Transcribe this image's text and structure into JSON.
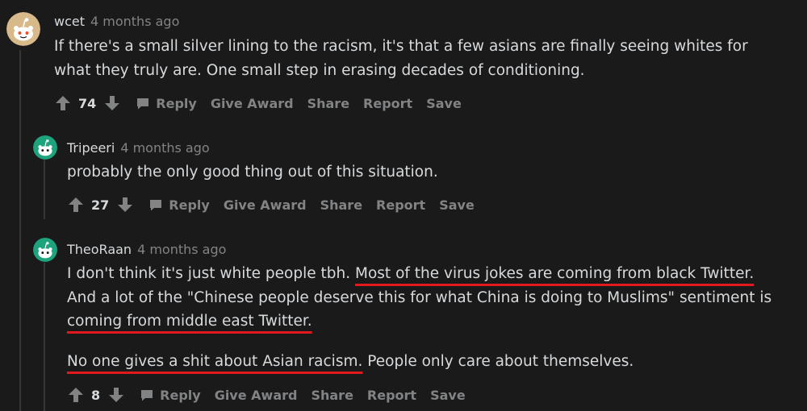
{
  "comments": [
    {
      "author": "wcet",
      "time": "4 months ago",
      "avatar_icon": "reddit-snoo-avatar-tan",
      "paragraphs": [
        "If there's a small silver lining to the racism, it's that a few asians are finally seeing whites for what they truly are. One small step in erasing decades of conditioning."
      ],
      "score": "74",
      "actions": {
        "reply": "Reply",
        "give_award": "Give Award",
        "share": "Share",
        "report": "Report",
        "save": "Save"
      }
    },
    {
      "author": "Tripeeri",
      "time": "4 months ago",
      "avatar_icon": "reddit-snoo-avatar-teal",
      "paragraphs": [
        "probably the only good thing out of this situation."
      ],
      "score": "27",
      "actions": {
        "reply": "Reply",
        "give_award": "Give Award",
        "share": "Share",
        "report": "Report",
        "save": "Save"
      }
    },
    {
      "author": "TheoRaan",
      "time": "4 months ago",
      "avatar_icon": "reddit-snoo-avatar-teal",
      "p1": {
        "a": "I don't think it's just white people tbh. ",
        "b": "Most of the virus jokes are coming from black Twitter.",
        "c": " And a lot of the \"Chinese people deserve this for what China is doing to Muslims\" sentiment is ",
        "d": "coming from middle east Twitter.",
        "e": ""
      },
      "p2": {
        "a": "No one gives a shit about Asian racism.",
        "b": " People only care about themselves."
      },
      "score": "8",
      "actions": {
        "reply": "Reply",
        "give_award": "Give Award",
        "share": "Share",
        "report": "Report",
        "save": "Save"
      }
    }
  ],
  "colors": {
    "background": "#1a1a1b",
    "text": "#d7dadc",
    "meta": "#818384",
    "underline_annotation": "#e0191f",
    "avatar_tan": "#d8b98a",
    "avatar_teal": "#1ea37f"
  }
}
